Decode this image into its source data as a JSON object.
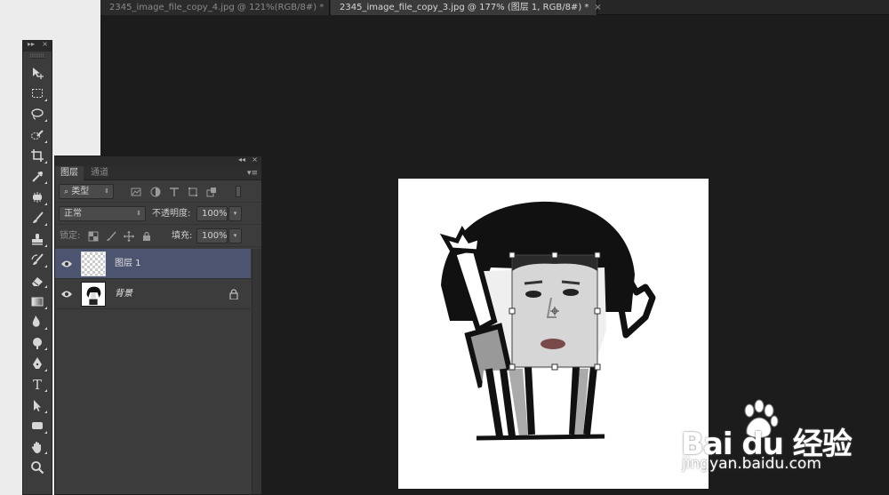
{
  "tabs": [
    {
      "label": "2345_image_file_copy_4.jpg @ 121%(RGB/8#) *",
      "close": "×"
    },
    {
      "label": "2345_image_file_copy_3.jpg @ 177% (图层 1, RGB/8#) *",
      "close": "×"
    }
  ],
  "toolbox": {
    "collapse": "▸▸",
    "close": "×",
    "tools": [
      "move-tool-icon",
      "marquee-tool-icon",
      "lasso-tool-icon",
      "quick-select-tool-icon",
      "crop-tool-icon",
      "eyedropper-tool-icon",
      "healing-brush-tool-icon",
      "brush-tool-icon",
      "clone-stamp-tool-icon",
      "history-brush-tool-icon",
      "eraser-tool-icon",
      "gradient-tool-icon",
      "blur-tool-icon",
      "dodge-tool-icon",
      "pen-tool-icon",
      "type-tool-icon",
      "path-select-tool-icon",
      "shape-tool-icon",
      "hand-tool-icon",
      "zoom-tool-icon"
    ],
    "type_glyph": "T"
  },
  "layers_panel": {
    "collapse": "◂◂",
    "close": "×",
    "menu": "▾≡",
    "tab_layers": "图层",
    "tab_channels": "通道",
    "filter_kind": "类型",
    "blend_mode": "正常",
    "opacity_label": "不透明度:",
    "opacity_value": "100%",
    "lock_label": "锁定:",
    "fill_label": "填充:",
    "fill_value": "100%",
    "layers": [
      {
        "name": "图层 1",
        "selected": true
      },
      {
        "name": "背景",
        "selected": false,
        "locked": true
      }
    ]
  },
  "watermark": {
    "brand": "Bai du 经验",
    "url": "jingyan.baidu.com"
  },
  "colors": {
    "workspace": "#1c1c1c",
    "panel": "#3c3c3c",
    "selected_layer": "#4c5470"
  }
}
